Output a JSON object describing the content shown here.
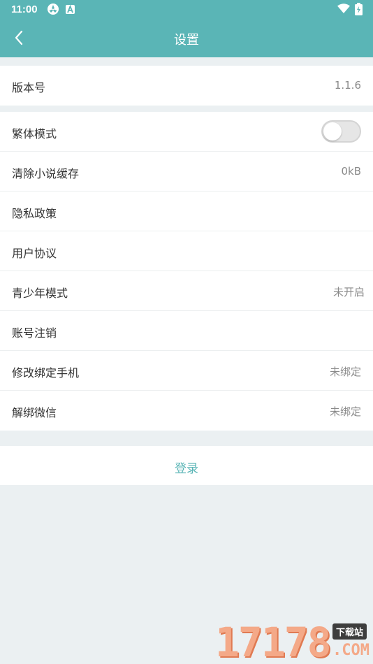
{
  "status_bar": {
    "time": "11:00"
  },
  "nav": {
    "title": "设置"
  },
  "version_section": {
    "label": "版本号",
    "value": "1.1.6"
  },
  "settings": {
    "traditional_mode": {
      "label": "繁体模式",
      "enabled": false
    },
    "clear_cache": {
      "label": "清除小说缓存",
      "value": "0kB"
    },
    "privacy_policy": {
      "label": "隐私政策"
    },
    "user_agreement": {
      "label": "用户协议"
    },
    "teen_mode": {
      "label": "青少年模式",
      "value": "未开启"
    },
    "account_cancel": {
      "label": "账号注销"
    },
    "change_phone": {
      "label": "修改绑定手机",
      "value": "未绑定"
    },
    "unbind_wechat": {
      "label": "解绑微信",
      "value": "未绑定"
    }
  },
  "login": {
    "label": "登录"
  },
  "watermark": {
    "digits": "17178",
    "tag": "下载站",
    "suffix": ".COM"
  },
  "colors": {
    "accent": "#5ab5b6",
    "background": "#ebf0f2"
  }
}
